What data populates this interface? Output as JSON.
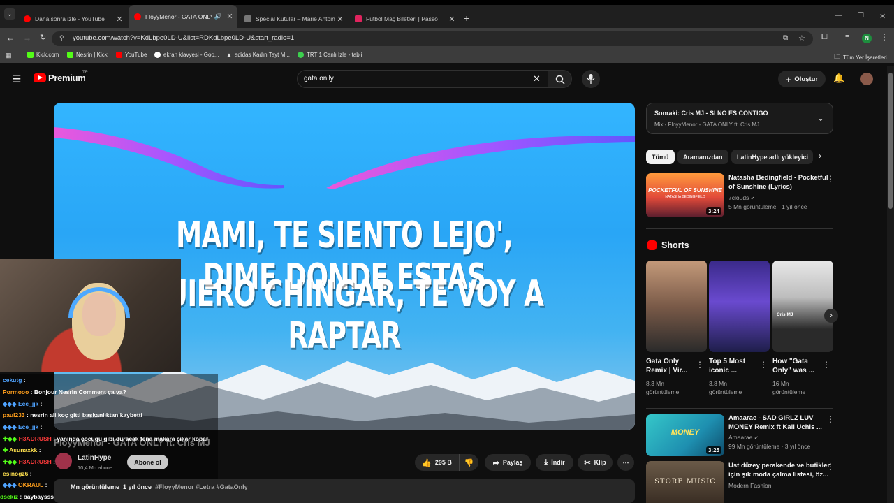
{
  "browser": {
    "tabs": [
      {
        "title": "Daha sonra izle - YouTube",
        "color": "#ff0000"
      },
      {
        "title": "FloyyMenor - GATA ONLY ft",
        "color": "#ff0000"
      },
      {
        "title": "Special Kutular – Marie Antoinette",
        "color": "#777777"
      },
      {
        "title": "Futbol Maç Biletleri | Passo",
        "color": "#e0245e"
      }
    ],
    "url": "youtube.com/watch?v=KdLbpe0LD-U&list=RDKdLbpe0LD-U&start_radio=1",
    "bookmarks": [
      {
        "label": "Kick.com",
        "color": "#53fc18"
      },
      {
        "label": "Nesrin | Kick",
        "color": "#53fc18"
      },
      {
        "label": "YouTube",
        "color": "#ff0000"
      },
      {
        "label": "ekran klavyesi - Goo...",
        "color": "#ffffff"
      },
      {
        "label": "adidas Kadın Tayt M...",
        "color": "#dddddd"
      },
      {
        "label": "TRT 1 Canlı İzle - tabii",
        "color": "#3ccf4e"
      }
    ],
    "all_bookmarks": "Tüm Yer İşaretleri",
    "profile_initial": "N"
  },
  "youtube": {
    "logo": "Premium",
    "logo_badge": "TR",
    "search_value": "gata onlly",
    "create_label": "Oluştur"
  },
  "video": {
    "lyric_line1": "MAMI, TE SIENTO LEJO', DIME DONDE ESTAS",
    "lyric_line2": "QUIERO CHINGAR, TE VOY A RAPTAR",
    "title": "FloyyMenor - GATA ONLY ft. Cris MJ",
    "channel": "LatinHype",
    "subscribers": "10,4 Mn abone",
    "subscribe_label": "Abone ol",
    "likes": "295 B",
    "share_label": "Paylaş",
    "download_label": "İndir",
    "clip_label": "Klip",
    "views_partial": "Mn görüntüleme",
    "date": "1 yıl önce",
    "hashtags": "#FloyyMenor #Letra #GataOnly"
  },
  "chat": [
    {
      "user": "cekutg",
      "text": "",
      "color": "#4fa3ff"
    },
    {
      "user": "Pormooo",
      "text": "Bonjour Nesrin Comment ça va?",
      "color": "#ff9f1c"
    },
    {
      "user": "Ece_jjk",
      "text": "",
      "color": "#4fa3ff"
    },
    {
      "user": "paul233",
      "text": "nesrin ali koç gitti başkanlıktan kaybetti",
      "color": "#ff9f1c"
    },
    {
      "user": "Ece_jjk",
      "text": "",
      "color": "#4fa3ff"
    },
    {
      "user": "H3ADRUSH",
      "text": "yanında çocuğu gibi duracak fena makara çıkar kopar",
      "color": "#ff3b3b"
    },
    {
      "user": "Asunaxkk",
      "text": "",
      "color": "#ffe14f"
    },
    {
      "user": "H3ADRUSH",
      "text": "",
      "color": "#ff3b3b"
    },
    {
      "user": "esinogz6",
      "text": "",
      "color": "#ffe14f"
    },
    {
      "user": "OKRAUL",
      "text": "",
      "color": "#ff9f1c"
    },
    {
      "user": "dsekiz",
      "text": "baybaysss nesrin",
      "color": "#53fc18"
    }
  ],
  "sidebar": {
    "next_label": "Sonraki: Cris MJ - SI NO ES CONTIGO",
    "mix_label": "Mix - FloyyMenor - GATA ONLY ft. Cris MJ",
    "chips": [
      "Tümü",
      "Aramanızdan",
      "LatinHype adlı yükleyici"
    ],
    "video1": {
      "title1": "Natasha Bedingfield - Pocketful",
      "title2": "of Sunshine (Lyrics)",
      "channel": "7clouds",
      "meta": "5 Mn görüntüleme · 1 yıl önce",
      "duration": "3:24",
      "thumb_text1": "POCKETFUL OF SUNSHINE",
      "thumb_text2": "NATASHA BEDINGFIELD"
    },
    "shorts_label": "Shorts",
    "shorts": [
      {
        "title1": "Gata Only",
        "title2": "Remix | Vir...",
        "views1": "8,3 Mn",
        "views2": "görüntüleme"
      },
      {
        "title1": "Top 5 Most",
        "title2": "iconic ...",
        "views1": "3,8 Mn",
        "views2": "görüntüleme"
      },
      {
        "title1": "How \"Gata",
        "title2": "Only\" was ...",
        "views1": "16 Mn",
        "views2": "görüntüleme"
      }
    ],
    "short3_overlay": "Cris MJ",
    "video2": {
      "title1": "Amaarae - SAD GIRLZ LUV",
      "title2": "MONEY Remix ft Kali Uchis ...",
      "channel": "Amaarae",
      "meta": "99 Mn görüntüleme · 3 yıl önce",
      "duration": "3:25",
      "thumb_text": "MONEY"
    },
    "video3": {
      "title1": "Üst düzey perakende ve butikler",
      "title2": "için şık moda çalma listesi, öz...",
      "channel": "Modern Fashion",
      "thumb_text": "STORE MUSIC"
    }
  }
}
